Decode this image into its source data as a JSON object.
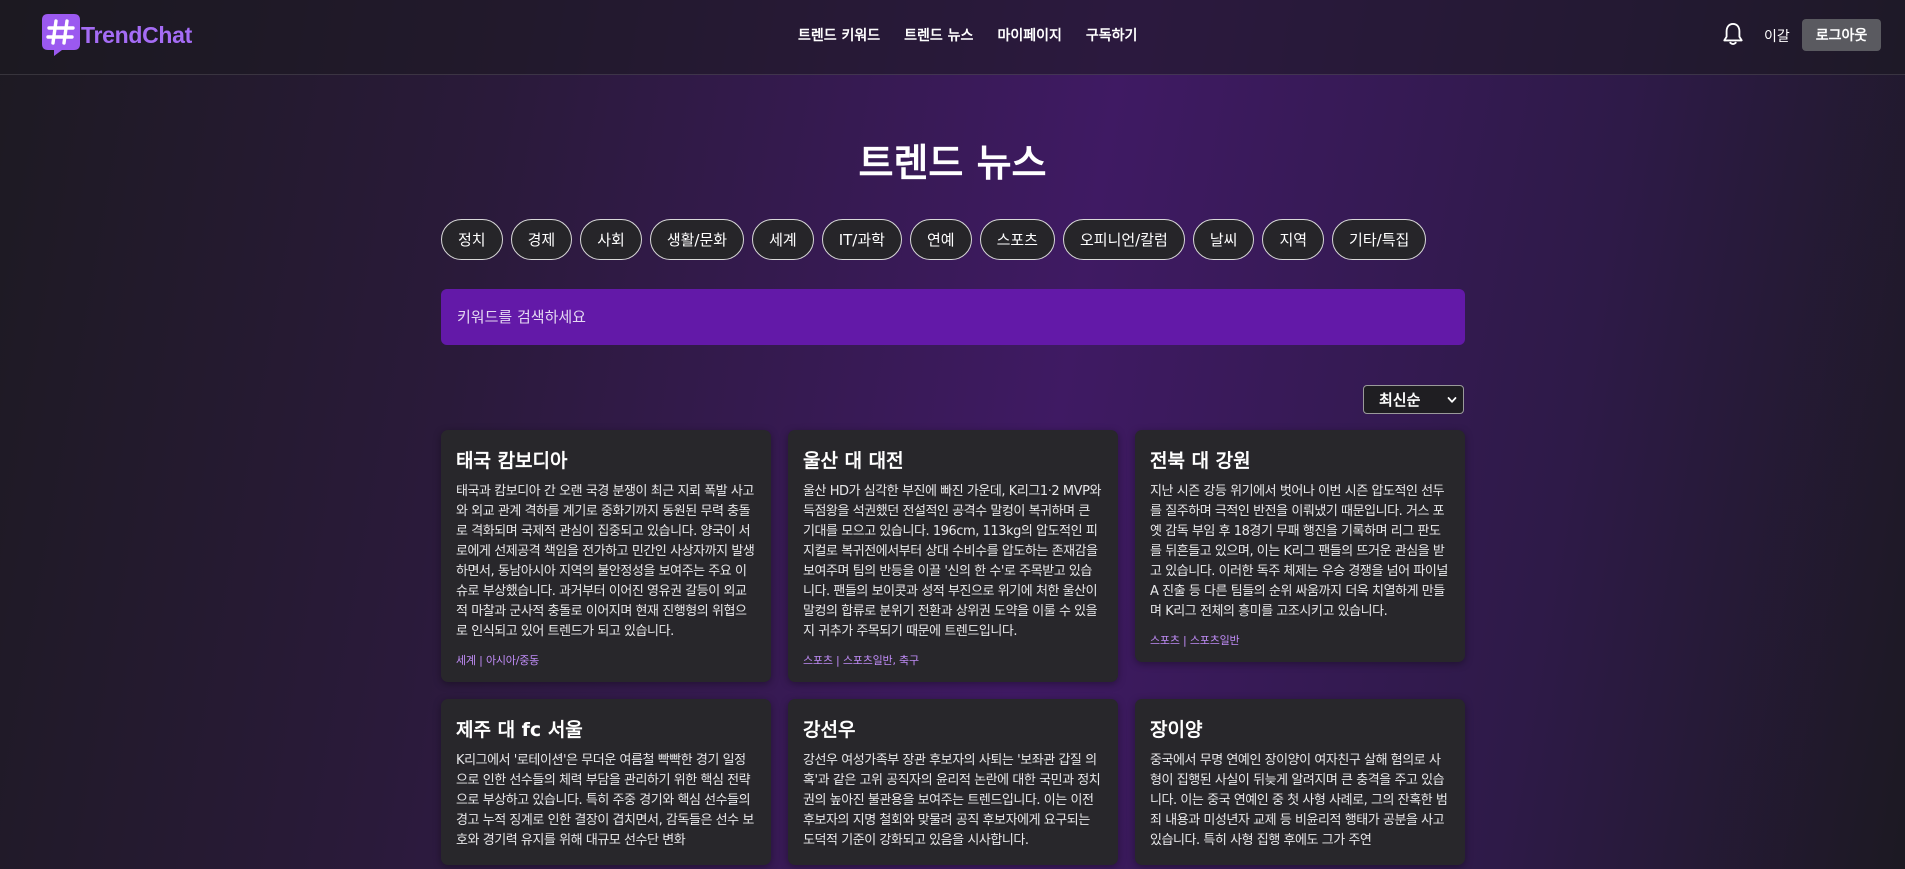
{
  "brand": {
    "name": "TrendChat",
    "accent": "#a56cf5"
  },
  "nav": {
    "items": [
      "트렌드 키워드",
      "트렌드 뉴스",
      "마이페이지",
      "구독하기"
    ]
  },
  "header": {
    "bell_icon": "bell-icon",
    "user": "이갈",
    "logout": "로그아웃"
  },
  "page": {
    "title": "트렌드 뉴스"
  },
  "categories": [
    "정치",
    "경제",
    "사회",
    "생활/문화",
    "세계",
    "IT/과학",
    "연예",
    "스포츠",
    "오피니언/칼럼",
    "날씨",
    "지역",
    "기타/특집"
  ],
  "search": {
    "placeholder": "키워드를 검색하세요",
    "value": ""
  },
  "sort": {
    "selected": "최신순"
  },
  "cards": [
    {
      "title": "태국 캄보디아",
      "body": "태국과 캄보디아 간 오랜 국경 분쟁이 최근 지뢰 폭발 사고와 외교 관계 격하를 계기로 중화기까지 동원된 무력 충돌로 격화되며 국제적 관심이 집중되고 있습니다. 양국이 서로에게 선제공격 책임을 전가하고 민간인 사상자까지 발생하면서, 동남아시아 지역의 불안정성을 보여주는 주요 이슈로 부상했습니다. 과거부터 이어진 영유권 갈등이 외교적 마찰과 군사적 충돌로 이어지며 현재 진행형의 위협으로 인식되고 있어 트렌드가 되고 있습니다.",
      "tags": "세계 | 아시아/중동"
    },
    {
      "title": "울산 대 대전",
      "body": "울산 HD가 심각한 부진에 빠진 가운데, K리그1·2 MVP와 득점왕을 석권했던 전설적인 공격수 말컹이 복귀하며 큰 기대를 모으고 있습니다. 196cm, 113kg의 압도적인 피지컬로 복귀전에서부터 상대 수비수를 압도하는 존재감을 보여주며 팀의 반등을 이끌 '신의 한 수'로 주목받고 있습니다. 팬들의 보이콧과 성적 부진으로 위기에 처한 울산이 말컹의 합류로 분위기 전환과 상위권 도약을 이룰 수 있을지 귀추가 주목되기 때문에 트렌드입니다.",
      "tags": "스포츠 | 스포츠일반, 축구"
    },
    {
      "title": "전북 대 강원",
      "body": "지난 시즌 강등 위기에서 벗어나 이번 시즌 압도적인 선두를 질주하며 극적인 반전을 이뤄냈기 때문입니다. 거스 포옛 감독 부임 후 18경기 무패 행진을 기록하며 리그 판도를 뒤흔들고 있으며, 이는 K리그 팬들의 뜨거운 관심을 받고 있습니다. 이러한 독주 체제는 우승 경쟁을 넘어 파이널 A 진출 등 다른 팀들의 순위 싸움까지 더욱 치열하게 만들며 K리그 전체의 흥미를 고조시키고 있습니다.",
      "tags": "스포츠 | 스포츠일반"
    },
    {
      "title": "제주 대 fc 서울",
      "body": "K리그에서 '로테이션'은 무더운 여름철 빡빡한 경기 일정으로 인한 선수들의 체력 부담을 관리하기 위한 핵심 전략으로 부상하고 있습니다. 특히 주중 경기와 핵심 선수들의 경고 누적 징계로 인한 결장이 겹치면서, 감독들은 선수 보호와 경기력 유지를 위해 대규모 선수단 변화",
      "tags": ""
    },
    {
      "title": "강선우",
      "body": "강선우 여성가족부 장관 후보자의 사퇴는 '보좌관 갑질 의혹'과 같은 고위 공직자의 윤리적 논란에 대한 국민과 정치권의 높아진 불관용을 보여주는 트렌드입니다. 이는 이전 후보자의 지명 철회와 맞물려 공직 후보자에게 요구되는 도덕적 기준이 강화되고 있음을 시사합니다.",
      "tags": ""
    },
    {
      "title": "장이양",
      "body": "중국에서 무명 연예인 장이양이 여자친구 살해 혐의로 사형이 집행된 사실이 뒤늦게 알려지며 큰 충격을 주고 있습니다. 이는 중국 연예인 중 첫 사형 사례로, 그의 잔혹한 범죄 내용과 미성년자 교제 등 비윤리적 행태가 공분을 사고 있습니다. 특히 사형 집행 후에도 그가 주연",
      "tags": ""
    }
  ]
}
